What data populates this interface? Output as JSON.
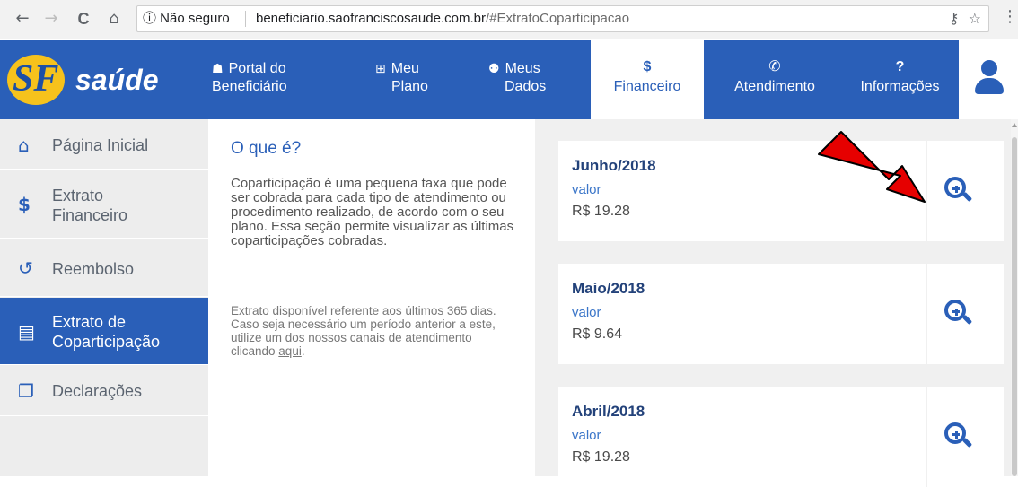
{
  "browser": {
    "security_label": "ⓘ Não seguro",
    "url_host": "beneficiario.saofranciscosaude.com.br",
    "url_path": "/#ExtratoCoparticipacao",
    "back_icon": "←",
    "forward_icon": "→",
    "reload_icon": "C",
    "home_icon": "⌂",
    "key_icon": "⚷",
    "star_icon": "☆",
    "menu_icon": "⋮"
  },
  "header": {
    "logo_text": "saúde",
    "logo_mark": "SF",
    "nav": [
      {
        "icon": "☗",
        "line1": "Portal do",
        "line2": "Beneficiário"
      },
      {
        "icon": "⊞",
        "line1": "Meu",
        "line2": "Plano"
      },
      {
        "icon": "⚉",
        "line1": "Meus",
        "line2": "Dados"
      },
      {
        "icon": "$",
        "line1": "",
        "line2": "Financeiro"
      },
      {
        "icon": "✆",
        "line1": "",
        "line2": "Atendimento"
      },
      {
        "icon": "?",
        "line1": "",
        "line2": "Informações"
      }
    ]
  },
  "sidebar": {
    "items": [
      {
        "icon": "⌂",
        "label": "Página Inicial"
      },
      {
        "icon": "$",
        "label": "Extrato\nFinanceiro"
      },
      {
        "icon": "↺",
        "label": "Reembolso"
      },
      {
        "icon": "▤",
        "label": "Extrato de\nCoparticipação"
      },
      {
        "icon": "❐",
        "label": "Declarações"
      }
    ]
  },
  "content": {
    "title": "O que é?",
    "description": "Coparticipação é uma pequena taxa que pode ser cobrada para cada tipo de atendimento ou procedimento realizado, de acordo com o seu plano. Essa seção permite visualizar as últimas coparticipações cobradas.",
    "note": "Extrato disponível referente aos últimos 365 dias. Caso seja necessário um período anterior a este, utilize um dos nossos canais de atendimento clicando",
    "note_link": "aqui",
    "note_end": "."
  },
  "statements": [
    {
      "month": "Junho/2018",
      "label": "valor",
      "amount": "R$ 19.28"
    },
    {
      "month": "Maio/2018",
      "label": "valor",
      "amount": "R$ 9.64"
    },
    {
      "month": "Abril/2018",
      "label": "valor",
      "amount": "R$ 19.28"
    }
  ],
  "colors": {
    "brand_blue": "#2a5fb8",
    "logo_yellow": "#f6c21c",
    "annotation_red": "#e60000"
  }
}
